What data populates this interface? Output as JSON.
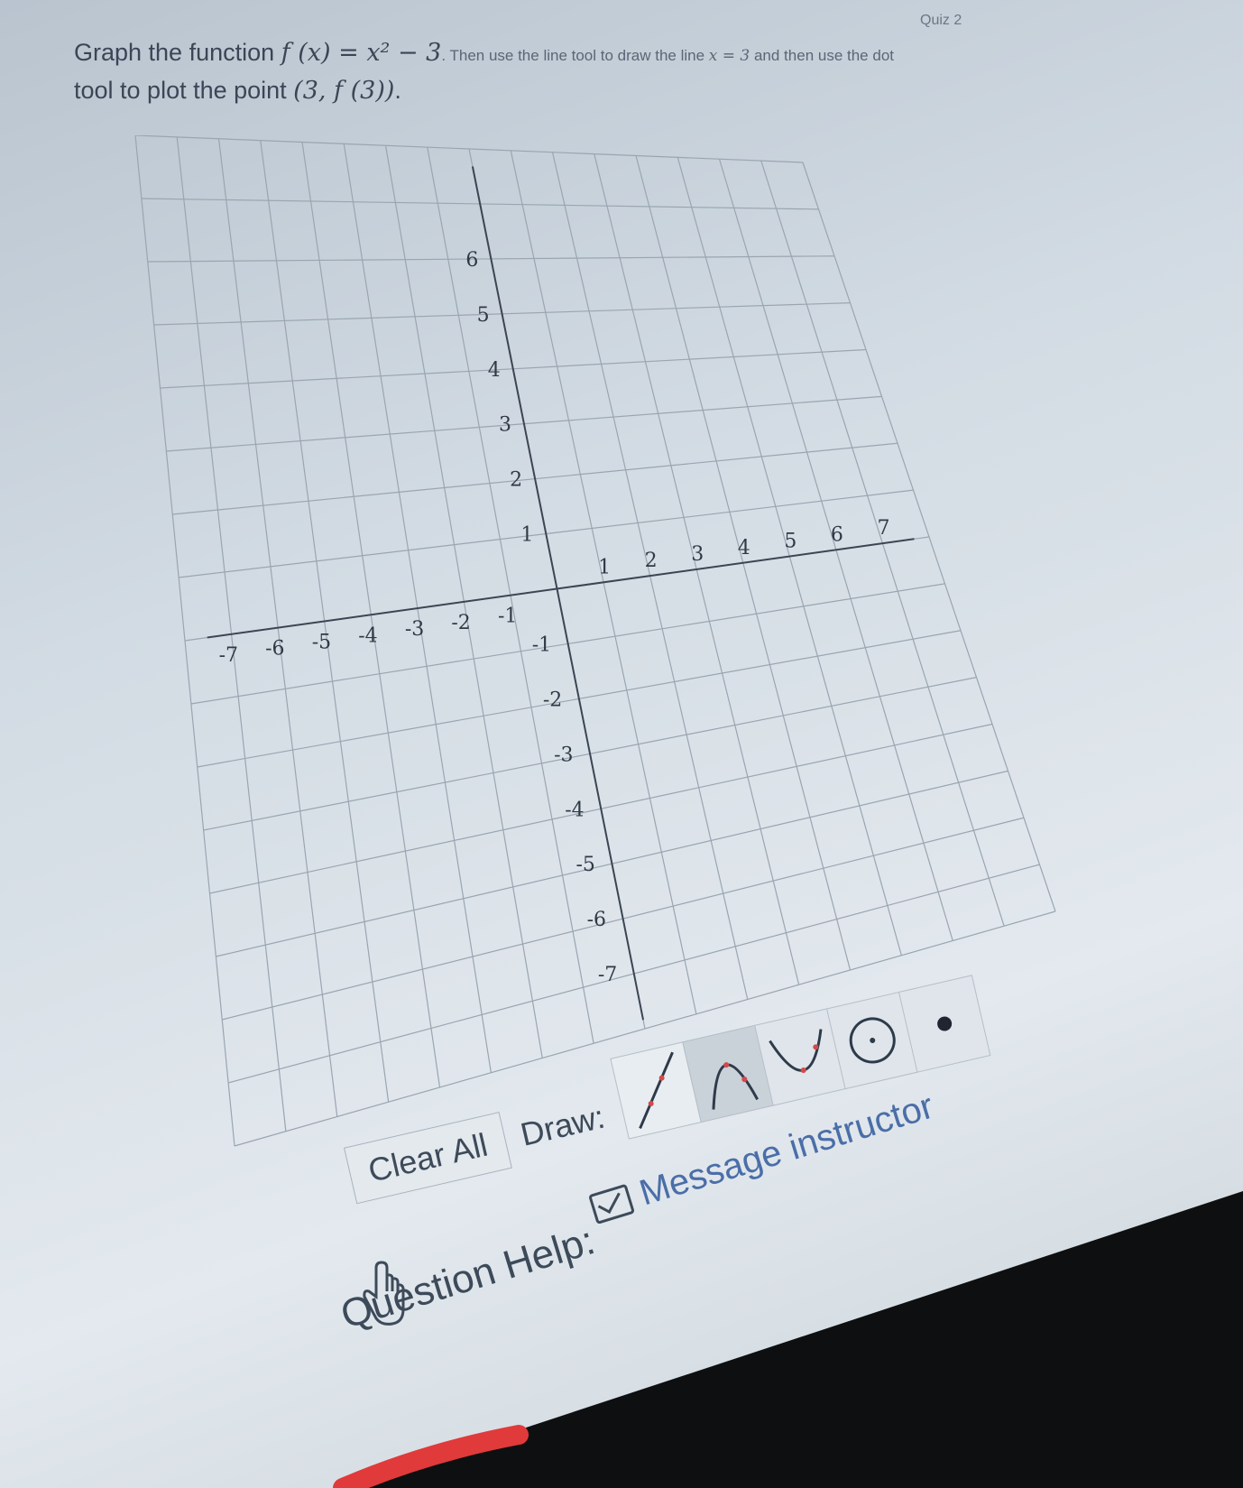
{
  "header": {
    "quiz_label": "Quiz 2"
  },
  "question": {
    "line1_pre": "Graph the function ",
    "function_expr": "f (x) = x² − 3",
    "line1_post": ". Then use the line tool to draw the line ",
    "line_expr": "x = 3",
    "line1_tail": " and then use the dot",
    "line2_pre": "tool to plot the point ",
    "point_expr": "(3, f (3))",
    "line2_post": "."
  },
  "graph": {
    "x_ticks": [
      "-7",
      "-6",
      "-5",
      "-4",
      "-3",
      "-2",
      "-1",
      "1",
      "2",
      "3",
      "4",
      "5",
      "6",
      "7"
    ],
    "y_ticks_pos": [
      "1",
      "2",
      "3",
      "4",
      "5",
      "6"
    ],
    "y_ticks_neg": [
      "-1",
      "-2",
      "-3",
      "-4",
      "-5",
      "-6",
      "-7"
    ]
  },
  "toolbar": {
    "clear_all_label": "Clear All",
    "draw_label": "Draw:",
    "tools": [
      "line-tool-icon",
      "parabola-up-tool-icon",
      "parabola-down-tool-icon",
      "circle-tool-icon",
      "dot-tool-icon"
    ]
  },
  "help": {
    "question_help_label": "Question Help:",
    "message_instructor_label": "Message instructor"
  },
  "colors": {
    "accent": "#d44a4a",
    "link": "#4a6ea8"
  }
}
